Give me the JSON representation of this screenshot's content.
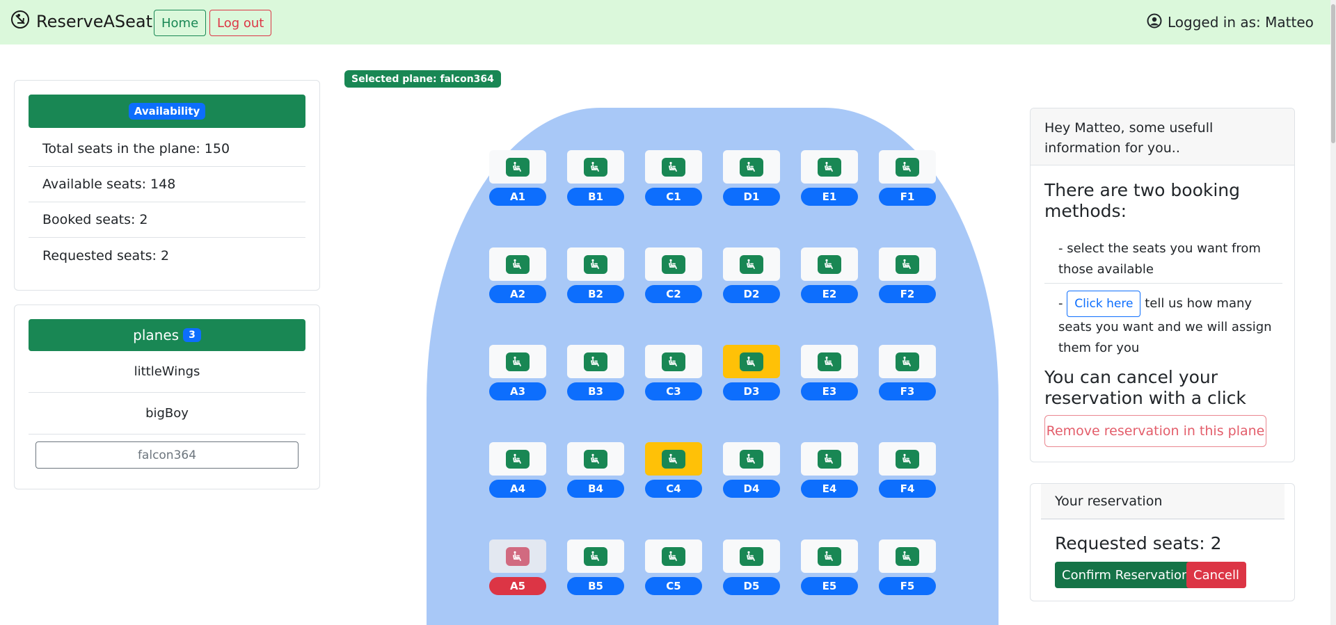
{
  "nav": {
    "brand": "ReserveASeat",
    "home_label": "Home",
    "logout_label": "Log out",
    "user_text": "Logged in as: Matteo"
  },
  "availability": {
    "header": "Availability",
    "total": "Total seats in the plane: 150",
    "available": "Available seats: 148",
    "booked": "Booked seats: 2",
    "requested": "Requested seats: 2"
  },
  "planes": {
    "header": "planes",
    "count": "3",
    "items": [
      "littleWings",
      "bigBoy"
    ],
    "selected": "falcon364"
  },
  "selected_plane_label": "Selected plane: falcon364",
  "seats": [
    {
      "id": "A1",
      "status": "available"
    },
    {
      "id": "B1",
      "status": "available"
    },
    {
      "id": "C1",
      "status": "available"
    },
    {
      "id": "D1",
      "status": "available"
    },
    {
      "id": "E1",
      "status": "available"
    },
    {
      "id": "F1",
      "status": "available"
    },
    {
      "id": "A2",
      "status": "available"
    },
    {
      "id": "B2",
      "status": "available"
    },
    {
      "id": "C2",
      "status": "available"
    },
    {
      "id": "D2",
      "status": "available"
    },
    {
      "id": "E2",
      "status": "available"
    },
    {
      "id": "F2",
      "status": "available"
    },
    {
      "id": "A3",
      "status": "available"
    },
    {
      "id": "B3",
      "status": "available"
    },
    {
      "id": "C3",
      "status": "available"
    },
    {
      "id": "D3",
      "status": "requested"
    },
    {
      "id": "E3",
      "status": "available"
    },
    {
      "id": "F3",
      "status": "available"
    },
    {
      "id": "A4",
      "status": "available"
    },
    {
      "id": "B4",
      "status": "available"
    },
    {
      "id": "C4",
      "status": "requested"
    },
    {
      "id": "D4",
      "status": "available"
    },
    {
      "id": "E4",
      "status": "available"
    },
    {
      "id": "F4",
      "status": "available"
    },
    {
      "id": "A5",
      "status": "booked"
    },
    {
      "id": "B5",
      "status": "available"
    },
    {
      "id": "C5",
      "status": "available"
    },
    {
      "id": "D5",
      "status": "available"
    },
    {
      "id": "E5",
      "status": "available"
    },
    {
      "id": "F5",
      "status": "available"
    }
  ],
  "info": {
    "header": "Hey Matteo, some usefull information for you..",
    "title": "There are two booking methods:",
    "method1": "- select the seats you want from those available",
    "method2_prefix": "-",
    "click_here": "Click here",
    "method2_suffix": "tell us how many seats you want and we will assign them for you",
    "cancel_text": "You can cancel your reservation with a click",
    "remove_button": "Remove reservation in this plane"
  },
  "reservation": {
    "header": "Your reservation",
    "requested": "Requested seats: 2",
    "confirm": "Confirm Reservation",
    "cancel": "Cancell"
  },
  "colors": {
    "navbar_bg": "#dbf8db",
    "success": "#198754",
    "primary": "#0d6efd",
    "danger": "#dc3545",
    "warning": "#ffc107",
    "fuselage": "#a8c8f7"
  }
}
